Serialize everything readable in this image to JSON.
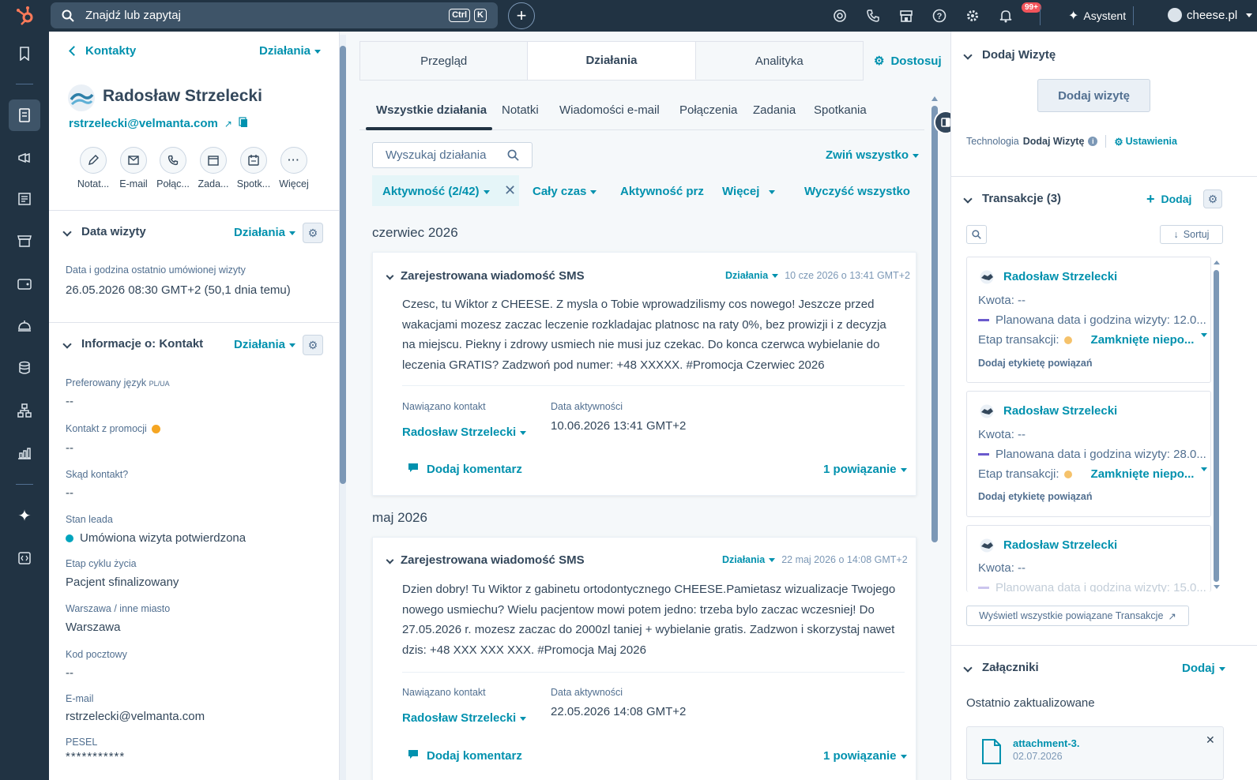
{
  "topbar": {
    "search_placeholder": "Znajdź lub zapytaj",
    "kbd_ctrl": "Ctrl",
    "kbd_k": "K",
    "notifications_badge": "99+",
    "assistant_label": "Asystent",
    "account_label": "cheese.pl"
  },
  "contact": {
    "back_label": "Kontakty",
    "actions_label": "Działania",
    "name": "Radosław Strzelecki",
    "email": "rstrzelecki@velmanta.com",
    "quick_actions": [
      "Notat...",
      "E-mail",
      "Połąc...",
      "Zada...",
      "Spotk...",
      "Więcej"
    ]
  },
  "visit_section": {
    "title": "Data wizyty",
    "actions_label": "Działania",
    "field_label": "Data i godzina ostatnio umówionej wizyty",
    "field_value": "26.05.2026 08:30 GMT+2 (50,1 dnia temu)"
  },
  "info_section": {
    "title": "Informacje o: Kontakt",
    "actions_label": "Działania",
    "fields": [
      {
        "label": "Preferowany język",
        "suffix": "PL/UA",
        "value": "--"
      },
      {
        "label": "Kontakt z promocji",
        "value": "--"
      },
      {
        "label": "Skąd kontakt?",
        "value": "--"
      },
      {
        "label": "Stan leada",
        "value": "Umówiona wizyta potwierdzona"
      },
      {
        "label": "Etap cyklu życia",
        "value": "Pacjent sfinalizowany"
      },
      {
        "label": "Warszawa / inne miasto",
        "value": "Warszawa"
      },
      {
        "label": "Kod pocztowy",
        "value": "--"
      },
      {
        "label": "E-mail",
        "value": "rstrzelecki@velmanta.com"
      },
      {
        "label": "PESEL",
        "value": "***********"
      }
    ]
  },
  "center": {
    "tabs": [
      "Przegląd",
      "Działania",
      "Analityka"
    ],
    "customize_label": "Dostosuj",
    "subtabs": [
      "Wszystkie działania",
      "Notatki",
      "Wiadomości e-mail",
      "Połączenia",
      "Zadania",
      "Spotkania"
    ],
    "search_placeholder": "Wyszukaj działania",
    "collapse_all": "Zwiń wszystko",
    "filters": [
      "Aktywność (2/42)",
      "Cały czas",
      "Aktywność prz",
      "Więcej",
      "Wyczyść wszystko"
    ],
    "months": [
      "czerwiec 2026",
      "maj 2026"
    ],
    "activities": [
      {
        "title": "Zarejestrowana wiadomość SMS",
        "actions_label": "Działania",
        "timestamp": "10 cze 2026 o 13:41 GMT+2",
        "body": "Czesc, tu Wiktor z CHEESE. Z mysla o Tobie wprowadzilismy cos nowego! Jeszcze przed wakacjami mozesz zaczac leczenie rozkladajac platnosc na raty 0%, bez prowizji i z decyzja na miejscu. Piekny i zdrowy usmiech nie musi juz czekac. Do konca czerwca wybielanie do leczenia GRATIS? Zadzwoń pod numer: +48 XXXXX. #Promocja Czerwiec 2026",
        "contact_label": "Nawiązano kontakt",
        "contact_value": "Radosław Strzelecki",
        "date_label": "Data aktywności",
        "date_value": "10.06.2026 13:41 GMT+2",
        "comment_label": "Dodaj komentarz",
        "assoc_label": "1 powiązanie"
      },
      {
        "title": "Zarejestrowana wiadomość SMS",
        "actions_label": "Działania",
        "timestamp": "22 maj 2026 o 14:08 GMT+2",
        "body": "Dzien dobry! Tu Wiktor z gabinetu ortodontycznego CHEESE.Pamietasz wizualizacje Twojego nowego usmiechu? Wielu pacjentow mowi potem jedno: trzeba bylo zaczac wczesniej! Do 27.05.2026 r. mozesz zaczac do 2000zl taniej + wybielanie gratis. Zadzwon i skorzystaj nawet dzis: +48 XXX XXX XXX. #Promocja Maj 2026",
        "contact_label": "Nawiązano kontakt",
        "contact_value": "Radosław Strzelecki",
        "date_label": "Data aktywności",
        "date_value": "22.05.2026 14:08 GMT+2",
        "comment_label": "Dodaj komentarz",
        "assoc_label": "1 powiązanie"
      }
    ]
  },
  "right": {
    "visit_title": "Dodaj Wizytę",
    "visit_button": "Dodaj wizytę",
    "tech_prefix": "Technologia",
    "tech_name": "Dodaj Wizytę",
    "settings_label": "Ustawienia",
    "deals_title": "Transakcje (3)",
    "deals_add": "Dodaj",
    "deals_sort": "Sortuj",
    "deals": [
      {
        "name": "Radosław Strzelecki",
        "amount": "Kwota: --",
        "planned": "Planowana data i godzina wizyty: 12.0...",
        "stage_label": "Etap transakcji:",
        "stage_value": "Zamknięte niepo...",
        "tag_link": "Dodaj etykietę powiązań"
      },
      {
        "name": "Radosław Strzelecki",
        "amount": "Kwota: --",
        "planned": "Planowana data i godzina wizyty: 28.0...",
        "stage_label": "Etap transakcji:",
        "stage_value": "Zamknięte niepo...",
        "tag_link": "Dodaj etykietę powiązań"
      },
      {
        "name": "Radosław Strzelecki",
        "amount": "Kwota: --",
        "planned": "Planowana data i godzina wizyty: 15.0..."
      }
    ],
    "view_all_deals": "Wyświetl wszystkie powiązane Transakcje",
    "attachments_title": "Załączniki",
    "attachments_add": "Dodaj",
    "attachments_sub": "Ostatnio zaktualizowane",
    "attachment_name": "attachment-3.",
    "attachment_date": "02.07.2026"
  },
  "colors": {
    "topbar_bg": "#213343",
    "accent": "#0091ae",
    "lead_status_dot": "#00a4bd",
    "stage_dot": "#f5c26b",
    "notification_badge": "#f2545b"
  }
}
